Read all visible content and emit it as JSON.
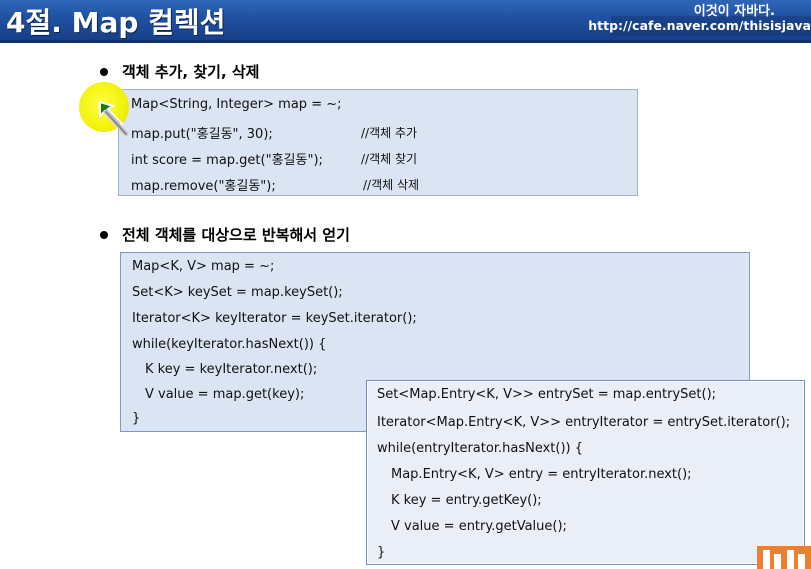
{
  "header": {
    "title": "4절. Map 컬렉션",
    "brand": "이것이 자바다.",
    "url": "http://cafe.naver.com/thisisjava"
  },
  "section1": {
    "heading": "객체 추가, 찾기, 삭제",
    "lines": [
      "Map<String, Integer> map = ~;",
      "map.put(\"홍길동\", 30);",
      "int score = map.get(\"홍길동\");",
      "map.remove(\"홍길동\");"
    ],
    "comments": [
      "//객체 추가",
      "//객체 찾기",
      "//객체 삭제"
    ]
  },
  "section2": {
    "heading": "전체 객체를 대상으로 반복해서 얻기",
    "keyset_lines": [
      "Map<K, V> map = ~;",
      "Set<K> keySet = map.keySet();",
      "Iterator<K> keyIterator = keySet.iterator();",
      "while(keyIterator.hasNext()) {",
      "K key = keyIterator.next();",
      "V value = map.get(key);",
      "}"
    ],
    "entry_lines": [
      "Set<Map.Entry<K, V>> entrySet = map.entrySet();",
      "Iterator<Map.Entry<K, V>> entryIterator = entrySet.iterator();",
      "while(entryIterator.hasNext()) {",
      "Map.Entry<K, V> entry = entryIterator.next();",
      "K key = entry.getKey();",
      "V value = entry.getValue();",
      "}"
    ]
  },
  "colors": {
    "header_bg": "#1f4f9f",
    "code_box_bg": "#dbe4f2",
    "highlight": "#f2f200",
    "logo": "#ef7f2e"
  }
}
